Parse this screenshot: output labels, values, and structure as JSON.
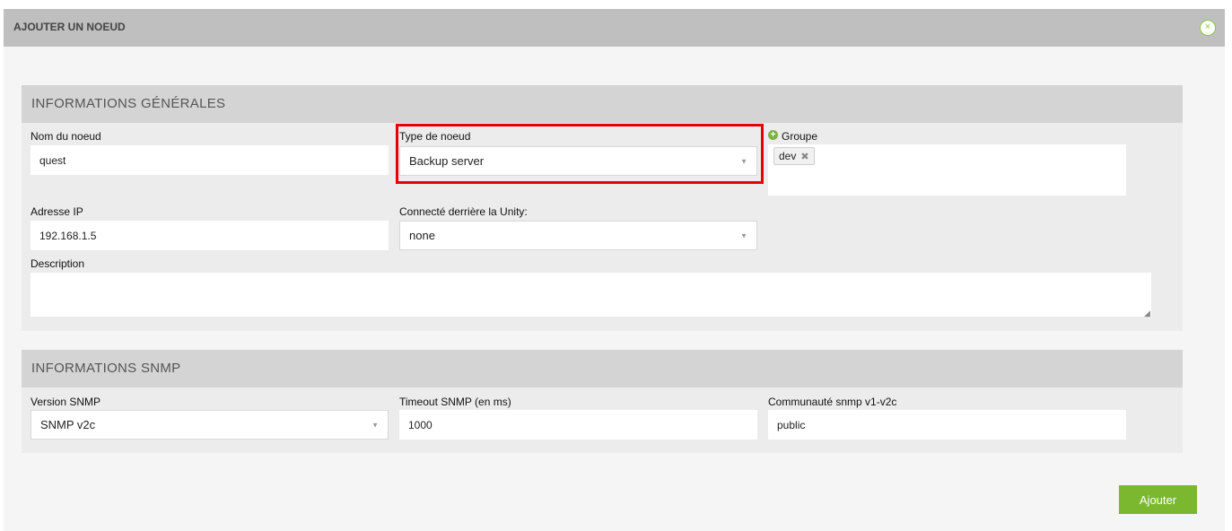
{
  "dialog": {
    "title": "AJOUTER UN NOEUD",
    "close_icon": "×"
  },
  "general": {
    "title": "INFORMATIONS GÉNÉRALES",
    "node_name": {
      "label": "Nom du noeud",
      "value": "quest"
    },
    "node_type": {
      "label": "Type de noeud",
      "value": "Backup server"
    },
    "group": {
      "label": "Groupe",
      "tags": [
        "dev"
      ],
      "remove_icon": "✖",
      "add_icon": "+"
    },
    "ip": {
      "label": "Adresse IP",
      "value": "192.168.1.5"
    },
    "behind_unity": {
      "label": "Connecté derrière la Unity:",
      "value": "none"
    },
    "description": {
      "label": "Description",
      "value": ""
    }
  },
  "snmp": {
    "title": "INFORMATIONS SNMP",
    "version": {
      "label": "Version SNMP",
      "value": "SNMP v2c"
    },
    "timeout": {
      "label": "Timeout SNMP (en ms)",
      "value": "1000"
    },
    "community": {
      "label": "Communauté snmp v1-v2c",
      "value": "public"
    }
  },
  "actions": {
    "submit_label": "Ajouter"
  },
  "colors": {
    "accent": "#7cb82f",
    "highlight": "#e60000"
  }
}
